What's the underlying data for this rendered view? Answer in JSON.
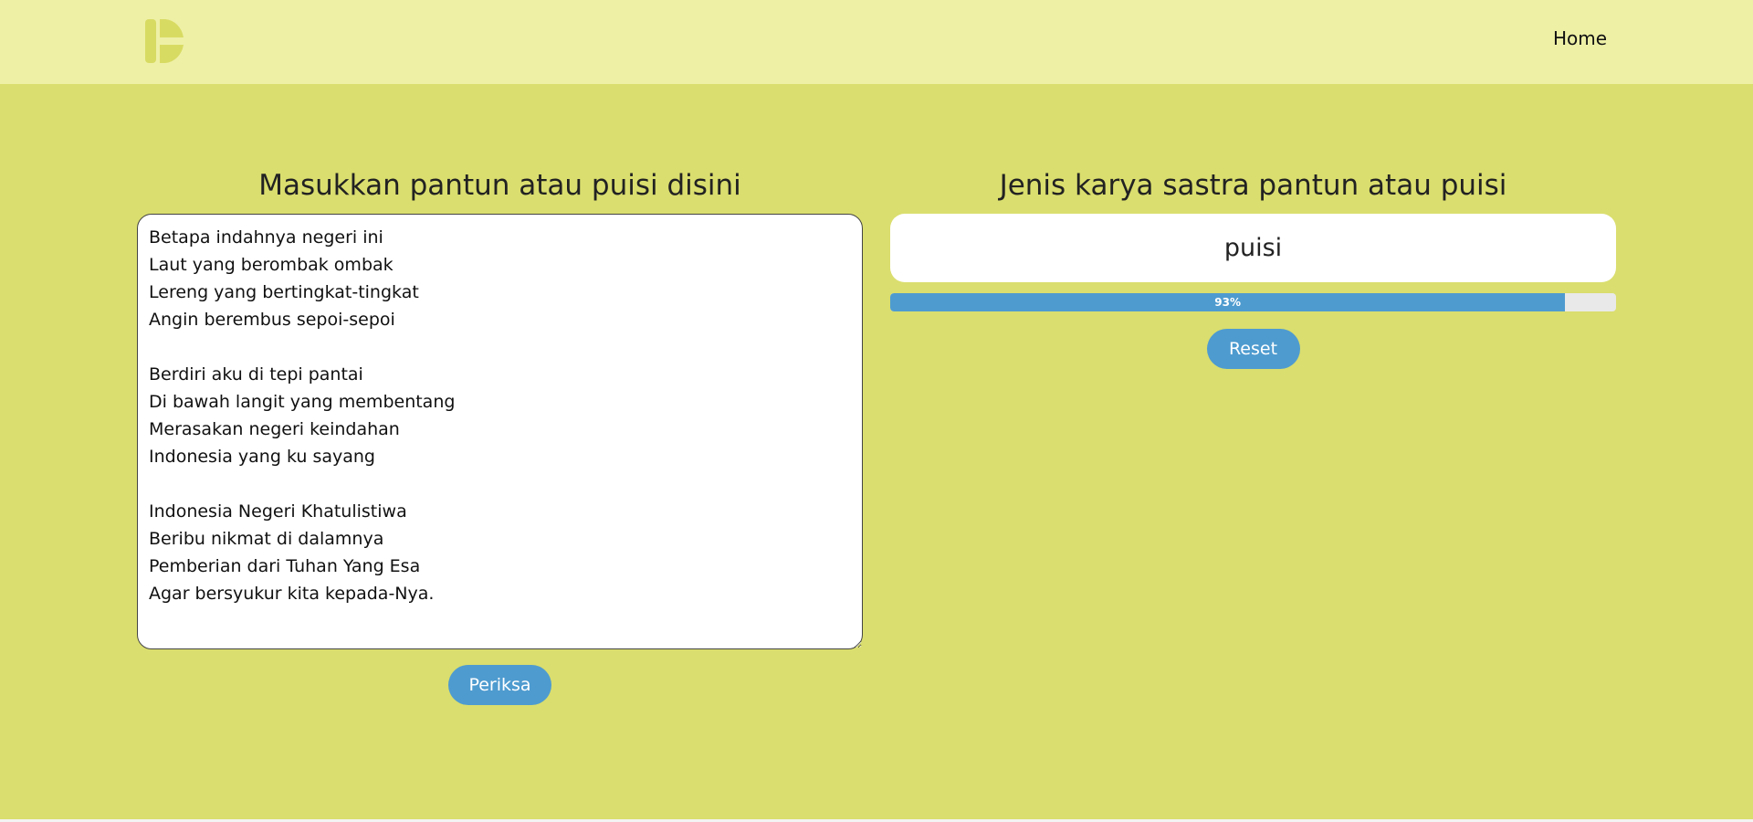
{
  "nav": {
    "logo_icon": "d-logo-icon",
    "home_label": "Home"
  },
  "input_panel": {
    "title": "Masukkan pantun atau puisi disini",
    "text": "Betapa indahnya negeri ini\nLaut yang berombak ombak\nLereng yang bertingkat-tingkat\nAngin berembus sepoi-sepoi\n\nBerdiri aku di tepi pantai\nDi bawah langit yang membentang\nMerasakan negeri keindahan\nIndonesia yang ku sayang\n\nIndonesia Negeri Khatulistiwa\nBeribu nikmat di dalamnya\nPemberian dari Tuhan Yang Esa\nAgar bersyukur kita kepada-Nya.",
    "check_button": "Periksa"
  },
  "result_panel": {
    "title": "Jenis karya sastra pantun atau puisi",
    "result": "puisi",
    "confidence_percent": 93,
    "confidence_label": "93%",
    "reset_button": "Reset"
  },
  "colors": {
    "page_background": "#dade6e",
    "navbar_background": "#eef0a6",
    "accent": "#4e9bcf",
    "logo": "#d8db62"
  }
}
